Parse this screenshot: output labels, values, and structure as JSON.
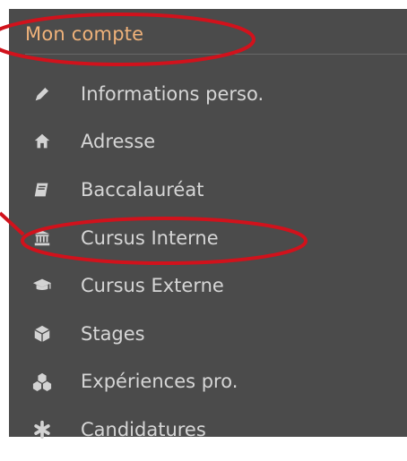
{
  "header": {
    "title": "Mon compte"
  },
  "menu": {
    "items": [
      {
        "label": "Informations perso.",
        "icon": "pencil-icon"
      },
      {
        "label": "Adresse",
        "icon": "home-icon"
      },
      {
        "label": "Baccalauréat",
        "icon": "book-icon"
      },
      {
        "label": "Cursus Interne",
        "icon": "bank-icon"
      },
      {
        "label": "Cursus Externe",
        "icon": "graduation-cap-icon"
      },
      {
        "label": "Stages",
        "icon": "cube-icon"
      },
      {
        "label": "Expériences pro.",
        "icon": "cubes-icon"
      },
      {
        "label": "Candidatures",
        "icon": "asterisk-icon"
      }
    ]
  },
  "colors": {
    "panel": "#4b4b4b",
    "header_text": "#f0b27a",
    "menu_text": "#d6d6d6",
    "highlight": "#d1121c"
  }
}
